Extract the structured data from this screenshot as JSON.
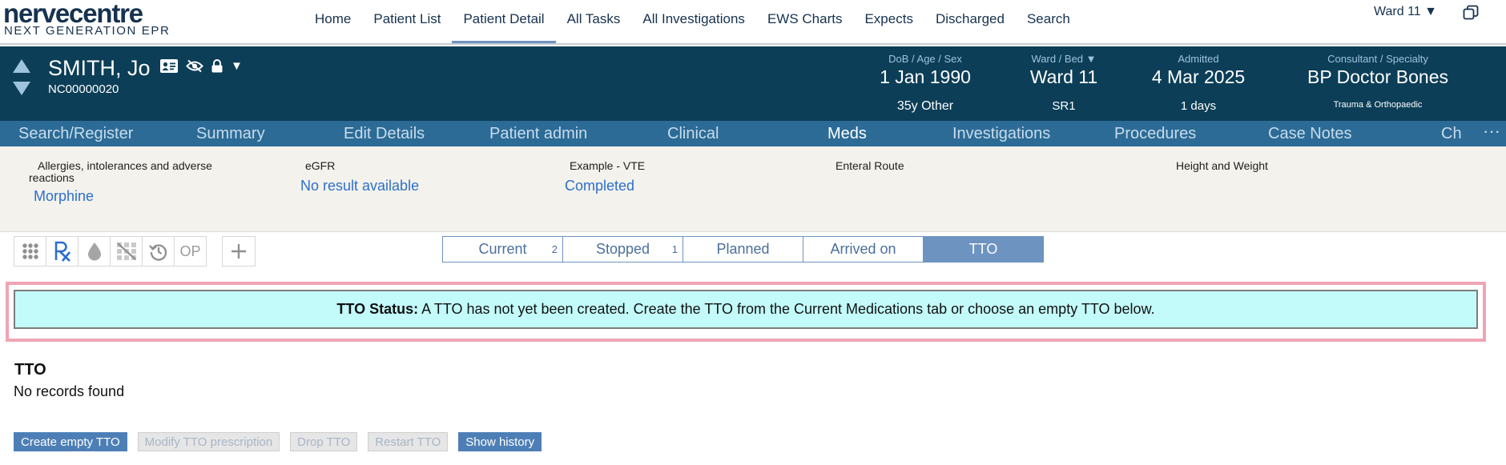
{
  "logo": {
    "main": "nervecentre",
    "sub": "NEXT GENERATION EPR"
  },
  "nav": {
    "items": [
      "Home",
      "Patient List",
      "Patient Detail",
      "All Tasks",
      "All Investigations",
      "EWS Charts",
      "Expects",
      "Discharged",
      "Search"
    ],
    "active": "Patient Detail"
  },
  "ward_selector": "Ward 11 ▼",
  "patient": {
    "name": "SMITH, Jo",
    "id": "NC00000020",
    "dob_label": "DoB / Age / Sex",
    "dob": "1 Jan 1990",
    "age_sex": "35y Other",
    "ward_label": "Ward / Bed  ▼",
    "ward": "Ward 11",
    "bed": "SR1",
    "admitted_label": "Admitted",
    "admitted": "4 Mar 2025",
    "admitted_days": "1 days",
    "consultant_label": "Consultant / Specialty",
    "consultant": "BP Doctor Bones",
    "specialty": "Trauma & Orthopaedic"
  },
  "module_tabs": {
    "items": [
      "Search/Register",
      "Summary",
      "Edit Details",
      "Patient admin",
      "Clinical",
      "Meds",
      "Investigations",
      "Procedures",
      "Case Notes",
      "Ch"
    ],
    "active": "Meds",
    "more": "···"
  },
  "summary": {
    "allergies_label": "Allergies, intolerances and adverse reactions",
    "allergies_value": "Morphine",
    "egfr_label": "eGFR",
    "egfr_value": "No result available",
    "vte_label": "Example - VTE",
    "vte_value": "Completed",
    "enteral_label": "Enteral Route",
    "height_label": "Height and Weight"
  },
  "toolbar": {
    "op_label": "OP"
  },
  "med_tabs": [
    {
      "label": "Current",
      "count": "2"
    },
    {
      "label": "Stopped",
      "count": "1"
    },
    {
      "label": "Planned",
      "count": ""
    },
    {
      "label": "Arrived on",
      "count": ""
    },
    {
      "label": "TTO",
      "count": ""
    }
  ],
  "med_tabs_active": "TTO",
  "status": {
    "label": "TTO Status:",
    "message": "A TTO has not yet been created. Create the TTO from the Current Medications tab or choose an empty TTO below."
  },
  "tto": {
    "title": "TTO",
    "empty_text": "No records found",
    "buttons": {
      "create": "Create empty TTO",
      "modify": "Modify TTO prescription",
      "drop": "Drop TTO",
      "restart": "Restart TTO",
      "history": "Show history"
    }
  },
  "colors": {
    "banner": "#0c3e57",
    "module_tabs": "#2c6b96",
    "summary_bg": "#f3f2ec",
    "status_bg": "#c3fafa",
    "status_border": "#f0a4b4",
    "accent": "#6d93c0",
    "link": "#2e6fcb"
  }
}
